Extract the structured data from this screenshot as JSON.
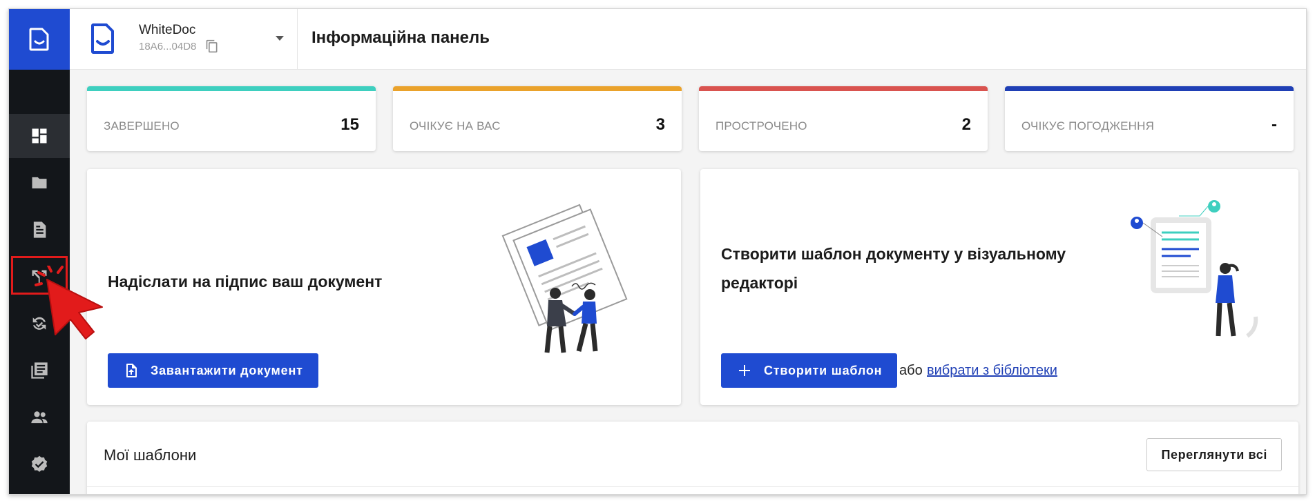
{
  "app": {
    "org_name": "WhiteDoc",
    "org_id": "18A6...04D8",
    "page_title": "Інформаційна панель"
  },
  "sidebar": {
    "items": [
      {
        "icon": "dashboard-icon",
        "active": true
      },
      {
        "icon": "folder-icon",
        "active": false
      },
      {
        "icon": "document-icon",
        "active": false
      },
      {
        "icon": "route-fork-icon",
        "active": false,
        "highlighted": true
      },
      {
        "icon": "sync-check-icon",
        "active": false
      },
      {
        "icon": "library-icon",
        "active": false
      },
      {
        "icon": "people-icon",
        "active": false
      },
      {
        "icon": "verified-badge-icon",
        "active": false
      }
    ]
  },
  "stats": [
    {
      "label": "ЗАВЕРШЕНО",
      "value": "15",
      "color": "#3ecfbf"
    },
    {
      "label": "ОЧІКУЄ НА ВАС",
      "value": "3",
      "color": "#eaa22b"
    },
    {
      "label": "ПРОСТРОЧЕНО",
      "value": "2",
      "color": "#d9534f"
    },
    {
      "label": "ОЧІКУЄ ПОГОДЖЕННЯ",
      "value": "-",
      "color": "#1f3fb5"
    }
  ],
  "send_card": {
    "title": "Надіслати на підпис ваш документ",
    "button": "Завантажити документ"
  },
  "template_card": {
    "title_line1": "Створити шаблон документу у візуальному",
    "title_line2": "редакторі",
    "button": "Створити шаблон",
    "or_text": "або",
    "link": "вибрати з бібліотеки"
  },
  "templates": {
    "title": "Мої шаблони",
    "view_all": "Переглянути всі"
  },
  "colors": {
    "brand": "#1f4bd1",
    "sidebar_bg": "#13161a",
    "highlight": "#e21b1b"
  }
}
